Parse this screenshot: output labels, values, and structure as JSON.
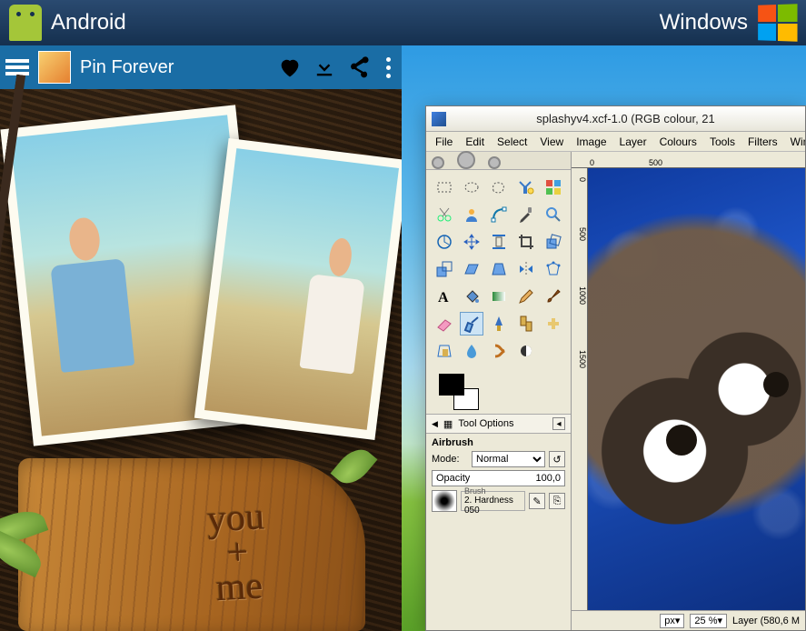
{
  "header": {
    "left_title": "Android",
    "right_title": "Windows"
  },
  "android": {
    "app_title": "Pin Forever",
    "carved_text": "you\n+\nme"
  },
  "gimp": {
    "title": "splashyv4.xcf-1.0 (RGB colour, 21",
    "menu": [
      "File",
      "Edit",
      "Select",
      "View",
      "Image",
      "Layer",
      "Colours",
      "Tools",
      "Filters",
      "Windows"
    ],
    "ruler_h": [
      "0",
      "500"
    ],
    "ruler_v": [
      "0",
      "500",
      "1000",
      "1500"
    ],
    "options_panel_label": "Tool Options",
    "tool_name": "Airbrush",
    "mode_label": "Mode:",
    "mode_value": "Normal",
    "opacity_label": "Opacity",
    "opacity_value": "100,0",
    "brush_label": "Brush",
    "brush_name": "2. Hardness 050",
    "status_unit": "px",
    "status_zoom": "25 %",
    "status_layer": "Layer (580,6 M"
  }
}
